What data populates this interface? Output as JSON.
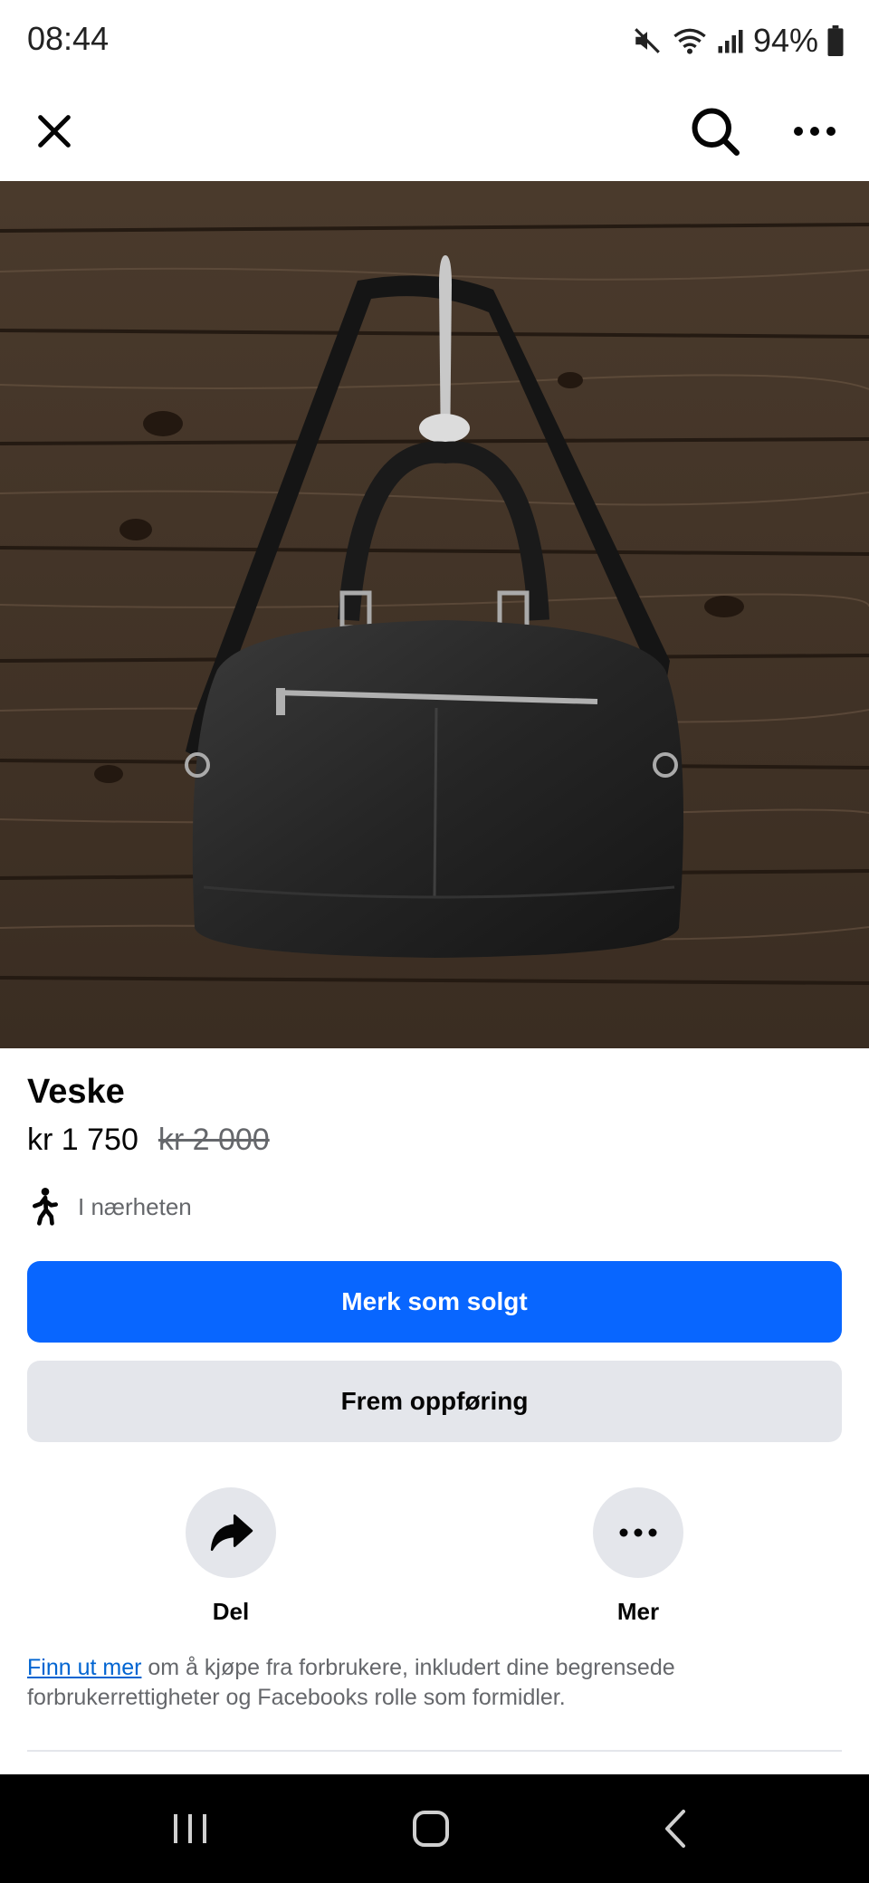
{
  "status": {
    "time": "08:44",
    "battery": "94%"
  },
  "topbar": {
    "close_icon": "close-icon",
    "search_icon": "search-icon",
    "more_icon": "more-icon"
  },
  "listing": {
    "title": "Veske",
    "price": "kr 1 750",
    "old_price": "kr 2 000",
    "location": "I nærheten",
    "location_icon": "walking-person-icon"
  },
  "buttons": {
    "mark_sold": "Merk som solgt",
    "promote": "Frem oppføring"
  },
  "actions": [
    {
      "label": "Del",
      "icon": "share-icon"
    },
    {
      "label": "Mer",
      "icon": "more-icon"
    }
  ],
  "footnote": {
    "link": "Finn ut mer",
    "text": " om å kjøpe fra forbrukere, inkludert dine begrensede forbrukerrettigheter og Facebooks rolle som formidler."
  },
  "colors": {
    "primary": "#0866ff",
    "secondary": "#e4e6eb",
    "link": "#0064d1"
  }
}
